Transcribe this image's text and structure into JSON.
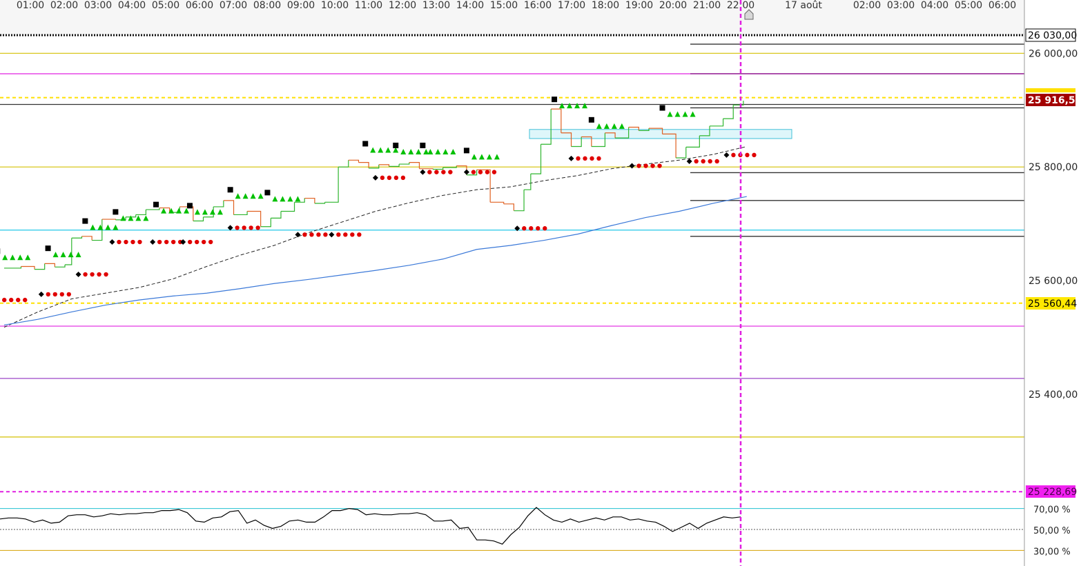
{
  "chart_data": {
    "type": "line",
    "time_labels": [
      "01:00",
      "02:00",
      "03:00",
      "04:00",
      "05:00",
      "06:00",
      "07:00",
      "08:00",
      "09:00",
      "10:00",
      "11:00",
      "12:00",
      "13:00",
      "14:00",
      "15:00",
      "16:00",
      "17:00",
      "18:00",
      "19:00",
      "20:00",
      "21:00",
      "22:00",
      "17 août",
      "02:00",
      "03:00",
      "04:00",
      "05:00",
      "06:00"
    ],
    "price_ticks": [
      "26 000,00",
      "25 800,00",
      "25 600,00",
      "25 400,00"
    ],
    "price_tick_values": [
      26000,
      25800,
      25600,
      25400
    ],
    "ylim": [
      25228.69,
      26030
    ],
    "osc_ticks": [
      "70,00 %",
      "50,00 %",
      "30,00 %"
    ],
    "osc_tick_values": [
      70,
      50,
      30
    ],
    "tags": {
      "top": "26 030,00",
      "current": "25 916,50",
      "low_yellow": "25 560,44",
      "bottom_magenta": "25 228,69"
    },
    "colors": {
      "price_up": "#2db52d",
      "price_down": "#e06020",
      "sma_fast": "#222222",
      "sma_slow": "#3a78d8",
      "sar_up": "#00c000",
      "sar_down": "#e00000",
      "current_tag": "#a30000",
      "yellow": "#d4c000",
      "magenta": "#e020e0",
      "cyan": "#20c8e8",
      "purple": "#9030c0"
    },
    "horizontal_levels": [
      {
        "value": 26000,
        "color": "#d4c000",
        "style": "solid"
      },
      {
        "value": 25964,
        "color": "#e020e0",
        "style": "solid"
      },
      {
        "value": 25922,
        "color": "#ffe000",
        "style": "dashed"
      },
      {
        "value": 25910,
        "color": "#333333",
        "style": "solid"
      },
      {
        "value": 25800,
        "color": "#d4c000",
        "style": "solid"
      },
      {
        "value": 25689,
        "color": "#20c8e8",
        "style": "solid"
      },
      {
        "value": 25560.44,
        "color": "#ffe000",
        "style": "dashed"
      },
      {
        "value": 25520,
        "color": "#e020e0",
        "style": "solid"
      },
      {
        "value": 25428,
        "color": "#9030c0",
        "style": "solid"
      },
      {
        "value": 25325,
        "color": "#d4c000",
        "style": "solid"
      },
      {
        "value": 25228.69,
        "color": "#e020e0",
        "style": "dashed"
      }
    ],
    "pivot_segments": [
      26016,
      25964,
      25904,
      25790,
      25741,
      25678
    ],
    "price_series": [
      {
        "h": 0.0,
        "v": 25622
      },
      {
        "h": 0.5,
        "v": 25625
      },
      {
        "h": 0.9,
        "v": 25620
      },
      {
        "h": 1.2,
        "v": 25630
      },
      {
        "h": 1.5,
        "v": 25624
      },
      {
        "h": 1.8,
        "v": 25628
      },
      {
        "h": 2.0,
        "v": 25675
      },
      {
        "h": 2.3,
        "v": 25678
      },
      {
        "h": 2.6,
        "v": 25671
      },
      {
        "h": 2.9,
        "v": 25708
      },
      {
        "h": 3.3,
        "v": 25707
      },
      {
        "h": 3.6,
        "v": 25712
      },
      {
        "h": 3.9,
        "v": 25716
      },
      {
        "h": 4.2,
        "v": 25725
      },
      {
        "h": 4.6,
        "v": 25728
      },
      {
        "h": 4.9,
        "v": 25720
      },
      {
        "h": 5.2,
        "v": 25730
      },
      {
        "h": 5.6,
        "v": 25705
      },
      {
        "h": 5.9,
        "v": 25712
      },
      {
        "h": 6.2,
        "v": 25730
      },
      {
        "h": 6.5,
        "v": 25741
      },
      {
        "h": 6.8,
        "v": 25716
      },
      {
        "h": 7.2,
        "v": 25722
      },
      {
        "h": 7.6,
        "v": 25695
      },
      {
        "h": 7.9,
        "v": 25710
      },
      {
        "h": 8.2,
        "v": 25722
      },
      {
        "h": 8.6,
        "v": 25738
      },
      {
        "h": 8.9,
        "v": 25745
      },
      {
        "h": 9.2,
        "v": 25736
      },
      {
        "h": 9.5,
        "v": 25738
      },
      {
        "h": 9.9,
        "v": 25800
      },
      {
        "h": 10.2,
        "v": 25812
      },
      {
        "h": 10.5,
        "v": 25808
      },
      {
        "h": 10.8,
        "v": 25798
      },
      {
        "h": 11.1,
        "v": 25804
      },
      {
        "h": 11.4,
        "v": 25801
      },
      {
        "h": 11.7,
        "v": 25805
      },
      {
        "h": 12.0,
        "v": 25808
      },
      {
        "h": 12.3,
        "v": 25797
      },
      {
        "h": 12.7,
        "v": 25796
      },
      {
        "h": 13.0,
        "v": 25799
      },
      {
        "h": 13.4,
        "v": 25802
      },
      {
        "h": 13.7,
        "v": 25786
      },
      {
        "h": 14.0,
        "v": 25795
      },
      {
        "h": 14.4,
        "v": 25738
      },
      {
        "h": 14.8,
        "v": 25735
      },
      {
        "h": 15.1,
        "v": 25723
      },
      {
        "h": 15.4,
        "v": 25760
      },
      {
        "h": 15.6,
        "v": 25788
      },
      {
        "h": 15.9,
        "v": 25840
      },
      {
        "h": 16.2,
        "v": 25902
      },
      {
        "h": 16.5,
        "v": 25860
      },
      {
        "h": 16.8,
        "v": 25836
      },
      {
        "h": 17.1,
        "v": 25853
      },
      {
        "h": 17.4,
        "v": 25836
      },
      {
        "h": 17.8,
        "v": 25860
      },
      {
        "h": 18.1,
        "v": 25851
      },
      {
        "h": 18.5,
        "v": 25870
      },
      {
        "h": 18.8,
        "v": 25864
      },
      {
        "h": 19.1,
        "v": 25868
      },
      {
        "h": 19.5,
        "v": 25858
      },
      {
        "h": 19.9,
        "v": 25816
      },
      {
        "h": 20.2,
        "v": 25835
      },
      {
        "h": 20.6,
        "v": 25855
      },
      {
        "h": 20.9,
        "v": 25872
      },
      {
        "h": 21.3,
        "v": 25885
      },
      {
        "h": 21.6,
        "v": 25909
      },
      {
        "h": 21.9,
        "v": 25916.5
      }
    ],
    "sma_fast": [
      {
        "h": 0.0,
        "v": 25518
      },
      {
        "h": 1.0,
        "v": 25545
      },
      {
        "h": 2.0,
        "v": 25568
      },
      {
        "h": 3.0,
        "v": 25578
      },
      {
        "h": 4.0,
        "v": 25588
      },
      {
        "h": 5.0,
        "v": 25603
      },
      {
        "h": 6.0,
        "v": 25625
      },
      {
        "h": 7.0,
        "v": 25645
      },
      {
        "h": 8.0,
        "v": 25662
      },
      {
        "h": 9.0,
        "v": 25684
      },
      {
        "h": 10.0,
        "v": 25703
      },
      {
        "h": 11.0,
        "v": 25722
      },
      {
        "h": 12.0,
        "v": 25737
      },
      {
        "h": 13.0,
        "v": 25750
      },
      {
        "h": 14.0,
        "v": 25760
      },
      {
        "h": 15.0,
        "v": 25765
      },
      {
        "h": 16.0,
        "v": 25776
      },
      {
        "h": 17.0,
        "v": 25785
      },
      {
        "h": 18.0,
        "v": 25797
      },
      {
        "h": 19.0,
        "v": 25805
      },
      {
        "h": 20.0,
        "v": 25812
      },
      {
        "h": 21.0,
        "v": 25822
      },
      {
        "h": 22.0,
        "v": 25836
      }
    ],
    "sma_slow": [
      {
        "h": 0.0,
        "v": 25522
      },
      {
        "h": 1.0,
        "v": 25532
      },
      {
        "h": 2.0,
        "v": 25545
      },
      {
        "h": 3.0,
        "v": 25557
      },
      {
        "h": 4.0,
        "v": 25566
      },
      {
        "h": 5.0,
        "v": 25573
      },
      {
        "h": 6.0,
        "v": 25578
      },
      {
        "h": 7.0,
        "v": 25586
      },
      {
        "h": 8.0,
        "v": 25595
      },
      {
        "h": 9.0,
        "v": 25602
      },
      {
        "h": 10.0,
        "v": 25610
      },
      {
        "h": 11.0,
        "v": 25618
      },
      {
        "h": 12.0,
        "v": 25627
      },
      {
        "h": 13.0,
        "v": 25638
      },
      {
        "h": 14.0,
        "v": 25655
      },
      {
        "h": 15.0,
        "v": 25662
      },
      {
        "h": 16.0,
        "v": 25671
      },
      {
        "h": 17.0,
        "v": 25682
      },
      {
        "h": 18.0,
        "v": 25697
      },
      {
        "h": 19.0,
        "v": 25711
      },
      {
        "h": 20.0,
        "v": 25722
      },
      {
        "h": 21.0,
        "v": 25736
      },
      {
        "h": 22.0,
        "v": 25748
      }
    ],
    "sar_up": [
      {
        "h": -0.2,
        "v": 25641
      },
      {
        "h": 1.3,
        "v": 25646
      },
      {
        "h": 2.4,
        "v": 25694
      },
      {
        "h": 3.3,
        "v": 25710
      },
      {
        "h": 4.5,
        "v": 25723
      },
      {
        "h": 5.5,
        "v": 25721
      },
      {
        "h": 6.7,
        "v": 25749
      },
      {
        "h": 7.8,
        "v": 25744
      },
      {
        "h": 10.7,
        "v": 25830
      },
      {
        "h": 11.6,
        "v": 25827
      },
      {
        "h": 12.4,
        "v": 25827
      },
      {
        "h": 13.7,
        "v": 25818
      },
      {
        "h": 16.3,
        "v": 25908
      },
      {
        "h": 17.4,
        "v": 25872
      },
      {
        "h": 19.5,
        "v": 25893
      }
    ],
    "sar_down": [
      {
        "h": -0.2,
        "v": 25566
      },
      {
        "h": 1.1,
        "v": 25576
      },
      {
        "h": 2.2,
        "v": 25611
      },
      {
        "h": 3.2,
        "v": 25668
      },
      {
        "h": 4.4,
        "v": 25668
      },
      {
        "h": 5.3,
        "v": 25668
      },
      {
        "h": 6.7,
        "v": 25693
      },
      {
        "h": 8.7,
        "v": 25681
      },
      {
        "h": 9.7,
        "v": 25681
      },
      {
        "h": 11.0,
        "v": 25781
      },
      {
        "h": 12.4,
        "v": 25791
      },
      {
        "h": 13.7,
        "v": 25791
      },
      {
        "h": 15.2,
        "v": 25692
      },
      {
        "h": 16.8,
        "v": 25815
      },
      {
        "h": 18.6,
        "v": 25802
      },
      {
        "h": 20.3,
        "v": 25810
      },
      {
        "h": 21.4,
        "v": 25821
      }
    ],
    "resistance_zone": [
      25850,
      25866
    ],
    "oscillator": [
      60,
      61,
      61,
      60,
      57,
      59,
      56,
      57,
      63,
      64,
      64,
      62,
      63,
      65,
      64,
      65,
      65,
      66,
      66,
      68,
      68,
      69,
      66,
      58,
      57,
      61,
      62,
      67,
      68,
      56,
      59,
      54,
      51,
      53,
      58,
      59,
      57,
      57,
      62,
      68,
      68,
      70,
      69,
      64,
      65,
      64,
      64,
      65,
      65,
      66,
      64,
      58,
      58,
      59,
      51,
      52,
      40,
      40,
      39,
      36,
      45,
      52,
      63,
      71,
      64,
      59,
      57,
      60,
      57,
      59,
      61,
      59,
      62,
      62,
      59,
      60,
      58,
      57,
      53,
      48,
      52,
      56,
      51,
      56,
      59,
      62,
      61,
      62
    ]
  }
}
